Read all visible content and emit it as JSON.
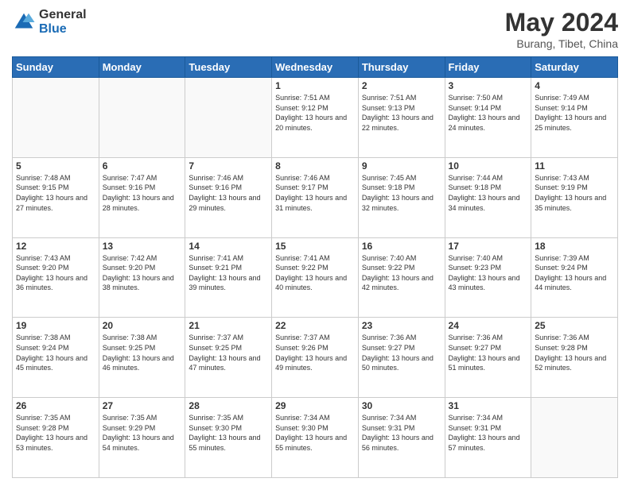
{
  "header": {
    "logo_general": "General",
    "logo_blue": "Blue",
    "title": "May 2024",
    "subtitle": "Burang, Tibet, China"
  },
  "days_of_week": [
    "Sunday",
    "Monday",
    "Tuesday",
    "Wednesday",
    "Thursday",
    "Friday",
    "Saturday"
  ],
  "weeks": [
    [
      {
        "day": "",
        "sunrise": "",
        "sunset": "",
        "daylight": "",
        "empty": true
      },
      {
        "day": "",
        "sunrise": "",
        "sunset": "",
        "daylight": "",
        "empty": true
      },
      {
        "day": "",
        "sunrise": "",
        "sunset": "",
        "daylight": "",
        "empty": true
      },
      {
        "day": "1",
        "sunrise": "Sunrise: 7:51 AM",
        "sunset": "Sunset: 9:12 PM",
        "daylight": "Daylight: 13 hours and 20 minutes."
      },
      {
        "day": "2",
        "sunrise": "Sunrise: 7:51 AM",
        "sunset": "Sunset: 9:13 PM",
        "daylight": "Daylight: 13 hours and 22 minutes."
      },
      {
        "day": "3",
        "sunrise": "Sunrise: 7:50 AM",
        "sunset": "Sunset: 9:14 PM",
        "daylight": "Daylight: 13 hours and 24 minutes."
      },
      {
        "day": "4",
        "sunrise": "Sunrise: 7:49 AM",
        "sunset": "Sunset: 9:14 PM",
        "daylight": "Daylight: 13 hours and 25 minutes."
      }
    ],
    [
      {
        "day": "5",
        "sunrise": "Sunrise: 7:48 AM",
        "sunset": "Sunset: 9:15 PM",
        "daylight": "Daylight: 13 hours and 27 minutes."
      },
      {
        "day": "6",
        "sunrise": "Sunrise: 7:47 AM",
        "sunset": "Sunset: 9:16 PM",
        "daylight": "Daylight: 13 hours and 28 minutes."
      },
      {
        "day": "7",
        "sunrise": "Sunrise: 7:46 AM",
        "sunset": "Sunset: 9:16 PM",
        "daylight": "Daylight: 13 hours and 29 minutes."
      },
      {
        "day": "8",
        "sunrise": "Sunrise: 7:46 AM",
        "sunset": "Sunset: 9:17 PM",
        "daylight": "Daylight: 13 hours and 31 minutes."
      },
      {
        "day": "9",
        "sunrise": "Sunrise: 7:45 AM",
        "sunset": "Sunset: 9:18 PM",
        "daylight": "Daylight: 13 hours and 32 minutes."
      },
      {
        "day": "10",
        "sunrise": "Sunrise: 7:44 AM",
        "sunset": "Sunset: 9:18 PM",
        "daylight": "Daylight: 13 hours and 34 minutes."
      },
      {
        "day": "11",
        "sunrise": "Sunrise: 7:43 AM",
        "sunset": "Sunset: 9:19 PM",
        "daylight": "Daylight: 13 hours and 35 minutes."
      }
    ],
    [
      {
        "day": "12",
        "sunrise": "Sunrise: 7:43 AM",
        "sunset": "Sunset: 9:20 PM",
        "daylight": "Daylight: 13 hours and 36 minutes."
      },
      {
        "day": "13",
        "sunrise": "Sunrise: 7:42 AM",
        "sunset": "Sunset: 9:20 PM",
        "daylight": "Daylight: 13 hours and 38 minutes."
      },
      {
        "day": "14",
        "sunrise": "Sunrise: 7:41 AM",
        "sunset": "Sunset: 9:21 PM",
        "daylight": "Daylight: 13 hours and 39 minutes."
      },
      {
        "day": "15",
        "sunrise": "Sunrise: 7:41 AM",
        "sunset": "Sunset: 9:22 PM",
        "daylight": "Daylight: 13 hours and 40 minutes."
      },
      {
        "day": "16",
        "sunrise": "Sunrise: 7:40 AM",
        "sunset": "Sunset: 9:22 PM",
        "daylight": "Daylight: 13 hours and 42 minutes."
      },
      {
        "day": "17",
        "sunrise": "Sunrise: 7:40 AM",
        "sunset": "Sunset: 9:23 PM",
        "daylight": "Daylight: 13 hours and 43 minutes."
      },
      {
        "day": "18",
        "sunrise": "Sunrise: 7:39 AM",
        "sunset": "Sunset: 9:24 PM",
        "daylight": "Daylight: 13 hours and 44 minutes."
      }
    ],
    [
      {
        "day": "19",
        "sunrise": "Sunrise: 7:38 AM",
        "sunset": "Sunset: 9:24 PM",
        "daylight": "Daylight: 13 hours and 45 minutes."
      },
      {
        "day": "20",
        "sunrise": "Sunrise: 7:38 AM",
        "sunset": "Sunset: 9:25 PM",
        "daylight": "Daylight: 13 hours and 46 minutes."
      },
      {
        "day": "21",
        "sunrise": "Sunrise: 7:37 AM",
        "sunset": "Sunset: 9:25 PM",
        "daylight": "Daylight: 13 hours and 47 minutes."
      },
      {
        "day": "22",
        "sunrise": "Sunrise: 7:37 AM",
        "sunset": "Sunset: 9:26 PM",
        "daylight": "Daylight: 13 hours and 49 minutes."
      },
      {
        "day": "23",
        "sunrise": "Sunrise: 7:36 AM",
        "sunset": "Sunset: 9:27 PM",
        "daylight": "Daylight: 13 hours and 50 minutes."
      },
      {
        "day": "24",
        "sunrise": "Sunrise: 7:36 AM",
        "sunset": "Sunset: 9:27 PM",
        "daylight": "Daylight: 13 hours and 51 minutes."
      },
      {
        "day": "25",
        "sunrise": "Sunrise: 7:36 AM",
        "sunset": "Sunset: 9:28 PM",
        "daylight": "Daylight: 13 hours and 52 minutes."
      }
    ],
    [
      {
        "day": "26",
        "sunrise": "Sunrise: 7:35 AM",
        "sunset": "Sunset: 9:28 PM",
        "daylight": "Daylight: 13 hours and 53 minutes."
      },
      {
        "day": "27",
        "sunrise": "Sunrise: 7:35 AM",
        "sunset": "Sunset: 9:29 PM",
        "daylight": "Daylight: 13 hours and 54 minutes."
      },
      {
        "day": "28",
        "sunrise": "Sunrise: 7:35 AM",
        "sunset": "Sunset: 9:30 PM",
        "daylight": "Daylight: 13 hours and 55 minutes."
      },
      {
        "day": "29",
        "sunrise": "Sunrise: 7:34 AM",
        "sunset": "Sunset: 9:30 PM",
        "daylight": "Daylight: 13 hours and 55 minutes."
      },
      {
        "day": "30",
        "sunrise": "Sunrise: 7:34 AM",
        "sunset": "Sunset: 9:31 PM",
        "daylight": "Daylight: 13 hours and 56 minutes."
      },
      {
        "day": "31",
        "sunrise": "Sunrise: 7:34 AM",
        "sunset": "Sunset: 9:31 PM",
        "daylight": "Daylight: 13 hours and 57 minutes."
      },
      {
        "day": "",
        "sunrise": "",
        "sunset": "",
        "daylight": "",
        "empty": true
      }
    ]
  ]
}
